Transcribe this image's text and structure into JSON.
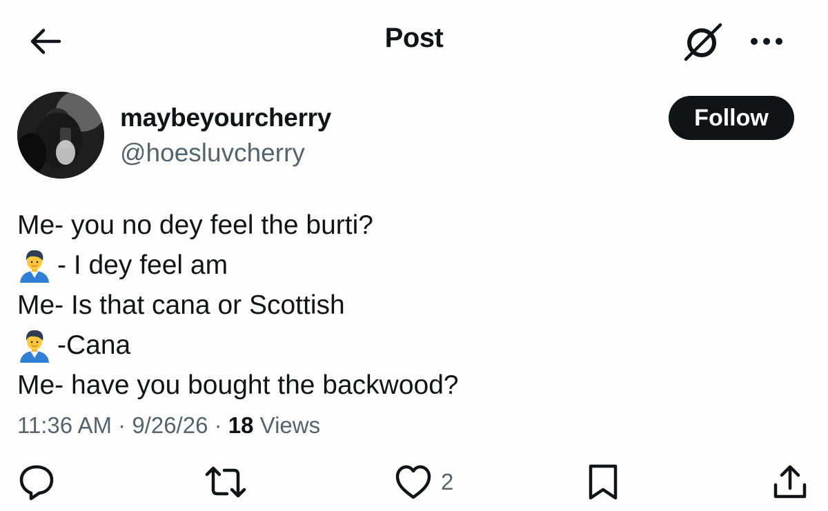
{
  "header": {
    "title": "Post",
    "back_icon": "arrow-left-icon",
    "grok_icon": "grok-slash-circle-icon",
    "more_icon": "more-horizontal-icon"
  },
  "author": {
    "display_name": "maybeyourcherry",
    "handle": "@hoesluvcherry",
    "follow_label": "Follow"
  },
  "post": {
    "lines": [
      {
        "emoji": false,
        "text": "Me- you no dey feel the burti?"
      },
      {
        "emoji": true,
        "text": "- I dey feel am"
      },
      {
        "emoji": false,
        "text": "Me- Is that cana or Scottish"
      },
      {
        "emoji": true,
        "text": "-Cana"
      },
      {
        "emoji": false,
        "text": "Me- have you bought the backwood?"
      }
    ]
  },
  "meta": {
    "time": "11:36 AM",
    "date": "9/26/26",
    "separator": "·",
    "views_count": "18",
    "views_label": "Views"
  },
  "actions": {
    "like_count": "2",
    "icons": [
      "reply-icon",
      "repost-icon",
      "like-icon",
      "bookmark-icon",
      "share-icon"
    ]
  },
  "colors": {
    "text_primary": "#0f1419",
    "text_secondary": "#536471",
    "background": "#fdfdfb",
    "follow_button_bg": "#0f1419"
  }
}
